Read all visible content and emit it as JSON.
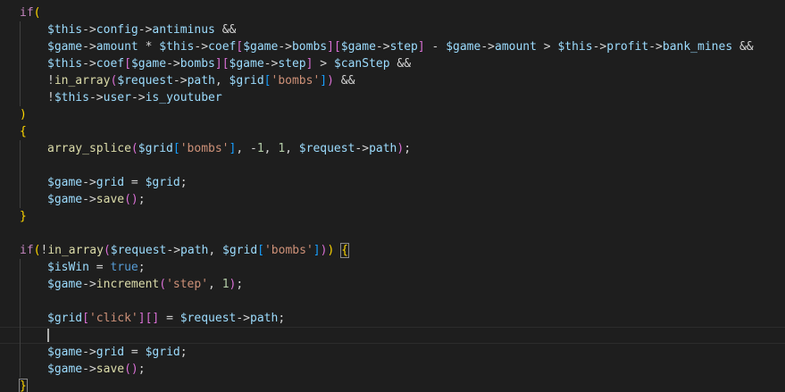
{
  "editor": {
    "language": "php",
    "colors": {
      "background": "#1e1e1e",
      "current_line_border": "#2c2c2c",
      "indent_guide": "#404040",
      "variable": "#9cdcfe",
      "keyword": "#c586c0",
      "control_keyword": "#c586c0",
      "function": "#dcdcaa",
      "string": "#ce9178",
      "number": "#b5cea8",
      "constant": "#569cd6",
      "operator": "#d4d4d4",
      "bracket_gold": "#ffd700",
      "bracket_purple": "#da70d6",
      "bracket_blue": "#179fff"
    },
    "lines": [
      {
        "text": "if(",
        "indent": 0,
        "tokens": [
          [
            "if",
            "control"
          ],
          [
            "(",
            "b1"
          ]
        ]
      },
      {
        "text": "$this->config->antiminus &&",
        "indent": 1,
        "tokens": [
          [
            "$this",
            "var"
          ],
          [
            "->",
            "op"
          ],
          [
            "config",
            "var"
          ],
          [
            "->",
            "op"
          ],
          [
            "antiminus",
            "var"
          ],
          [
            " &&",
            "op"
          ]
        ]
      },
      {
        "text": "$game->amount * $this->coef[$game->bombs][$game->step] - $game->amount > $this->profit->bank_mines &&",
        "indent": 1,
        "tokens": [
          [
            "$game",
            "var"
          ],
          [
            "->",
            "op"
          ],
          [
            "amount",
            "var"
          ],
          [
            " * ",
            "op"
          ],
          [
            "$this",
            "var"
          ],
          [
            "->",
            "op"
          ],
          [
            "coef",
            "var"
          ],
          [
            "[",
            "b2"
          ],
          [
            "$game",
            "var"
          ],
          [
            "->",
            "op"
          ],
          [
            "bombs",
            "var"
          ],
          [
            "]",
            "b2"
          ],
          [
            "[",
            "b2"
          ],
          [
            "$game",
            "var"
          ],
          [
            "->",
            "op"
          ],
          [
            "step",
            "var"
          ],
          [
            "]",
            "b2"
          ],
          [
            " - ",
            "op"
          ],
          [
            "$game",
            "var"
          ],
          [
            "->",
            "op"
          ],
          [
            "amount",
            "var"
          ],
          [
            " > ",
            "op"
          ],
          [
            "$this",
            "var"
          ],
          [
            "->",
            "op"
          ],
          [
            "profit",
            "var"
          ],
          [
            "->",
            "op"
          ],
          [
            "bank_mines",
            "var"
          ],
          [
            " &&",
            "op"
          ]
        ]
      },
      {
        "text": "$this->coef[$game->bombs][$game->step] > $canStep &&",
        "indent": 1,
        "tokens": [
          [
            "$this",
            "var"
          ],
          [
            "->",
            "op"
          ],
          [
            "coef",
            "var"
          ],
          [
            "[",
            "b2"
          ],
          [
            "$game",
            "var"
          ],
          [
            "->",
            "op"
          ],
          [
            "bombs",
            "var"
          ],
          [
            "]",
            "b2"
          ],
          [
            "[",
            "b2"
          ],
          [
            "$game",
            "var"
          ],
          [
            "->",
            "op"
          ],
          [
            "step",
            "var"
          ],
          [
            "]",
            "b2"
          ],
          [
            " > ",
            "op"
          ],
          [
            "$canStep",
            "var"
          ],
          [
            " &&",
            "op"
          ]
        ]
      },
      {
        "text": "!in_array($request->path, $grid['bombs']) &&",
        "indent": 1,
        "tokens": [
          [
            "!",
            "op"
          ],
          [
            "in_array",
            "fn"
          ],
          [
            "(",
            "b2"
          ],
          [
            "$request",
            "var"
          ],
          [
            "->",
            "op"
          ],
          [
            "path",
            "var"
          ],
          [
            ", ",
            "op"
          ],
          [
            "$grid",
            "var"
          ],
          [
            "[",
            "b3"
          ],
          [
            "'bombs'",
            "str"
          ],
          [
            "]",
            "b3"
          ],
          [
            ")",
            "b2"
          ],
          [
            " &&",
            "op"
          ]
        ]
      },
      {
        "text": "!$this->user->is_youtuber",
        "indent": 1,
        "tokens": [
          [
            "!",
            "op"
          ],
          [
            "$this",
            "var"
          ],
          [
            "->",
            "op"
          ],
          [
            "user",
            "var"
          ],
          [
            "->",
            "op"
          ],
          [
            "is_youtuber",
            "var"
          ]
        ]
      },
      {
        "text": ")",
        "indent": 0,
        "tokens": [
          [
            ")",
            "b1"
          ]
        ]
      },
      {
        "text": "{",
        "indent": 0,
        "tokens": [
          [
            "{",
            "b1"
          ]
        ]
      },
      {
        "text": "array_splice($grid['bombs'], -1, 1, $request->path);",
        "indent": 1,
        "tokens": [
          [
            "array_splice",
            "fn"
          ],
          [
            "(",
            "b2"
          ],
          [
            "$grid",
            "var"
          ],
          [
            "[",
            "b3"
          ],
          [
            "'bombs'",
            "str"
          ],
          [
            "]",
            "b3"
          ],
          [
            ", ",
            "op"
          ],
          [
            "-",
            "op"
          ],
          [
            "1",
            "num"
          ],
          [
            ", ",
            "op"
          ],
          [
            "1",
            "num"
          ],
          [
            ", ",
            "op"
          ],
          [
            "$request",
            "var"
          ],
          [
            "->",
            "op"
          ],
          [
            "path",
            "var"
          ],
          [
            ")",
            "b2"
          ],
          [
            ";",
            "op"
          ]
        ]
      },
      {
        "text": "",
        "indent": 1,
        "tokens": []
      },
      {
        "text": "$game->grid = $grid;",
        "indent": 1,
        "tokens": [
          [
            "$game",
            "var"
          ],
          [
            "->",
            "op"
          ],
          [
            "grid",
            "var"
          ],
          [
            " = ",
            "op"
          ],
          [
            "$grid",
            "var"
          ],
          [
            ";",
            "op"
          ]
        ]
      },
      {
        "text": "$game->save();",
        "indent": 1,
        "tokens": [
          [
            "$game",
            "var"
          ],
          [
            "->",
            "op"
          ],
          [
            "save",
            "fn"
          ],
          [
            "()",
            "b2"
          ],
          [
            ";",
            "op"
          ]
        ]
      },
      {
        "text": "}",
        "indent": 0,
        "tokens": [
          [
            "}",
            "b1"
          ]
        ]
      },
      {
        "text": "",
        "indent": 0,
        "tokens": []
      },
      {
        "text": "if(!in_array($request->path, $grid['bombs'])) {",
        "indent": 0,
        "tokens": [
          [
            "if",
            "control"
          ],
          [
            "(",
            "b1"
          ],
          [
            "!",
            "op"
          ],
          [
            "in_array",
            "fn"
          ],
          [
            "(",
            "b2"
          ],
          [
            "$request",
            "var"
          ],
          [
            "->",
            "op"
          ],
          [
            "path",
            "var"
          ],
          [
            ", ",
            "op"
          ],
          [
            "$grid",
            "var"
          ],
          [
            "[",
            "b3"
          ],
          [
            "'bombs'",
            "str"
          ],
          [
            "]",
            "b3"
          ],
          [
            ")",
            "b2"
          ],
          [
            ")",
            "b1"
          ],
          [
            " ",
            "op"
          ],
          [
            "{",
            "b1box"
          ]
        ]
      },
      {
        "text": "$isWin = true;",
        "indent": 1,
        "tokens": [
          [
            "$isWin",
            "var"
          ],
          [
            " = ",
            "op"
          ],
          [
            "true",
            "const"
          ],
          [
            ";",
            "op"
          ]
        ]
      },
      {
        "text": "$game->increment('step', 1);",
        "indent": 1,
        "tokens": [
          [
            "$game",
            "var"
          ],
          [
            "->",
            "op"
          ],
          [
            "increment",
            "fn"
          ],
          [
            "(",
            "b2"
          ],
          [
            "'step'",
            "str"
          ],
          [
            ", ",
            "op"
          ],
          [
            "1",
            "num"
          ],
          [
            ")",
            "b2"
          ],
          [
            ";",
            "op"
          ]
        ]
      },
      {
        "text": "",
        "indent": 1,
        "tokens": []
      },
      {
        "text": "$grid['click'][] = $request->path;",
        "indent": 1,
        "tokens": [
          [
            "$grid",
            "var"
          ],
          [
            "[",
            "b2"
          ],
          [
            "'click'",
            "str"
          ],
          [
            "]",
            "b2"
          ],
          [
            "[]",
            "b2"
          ],
          [
            " = ",
            "op"
          ],
          [
            "$request",
            "var"
          ],
          [
            "->",
            "op"
          ],
          [
            "path",
            "var"
          ],
          [
            ";",
            "op"
          ]
        ]
      },
      {
        "text": "",
        "indent": 1,
        "tokens": [],
        "current": true
      },
      {
        "text": "$game->grid = $grid;",
        "indent": 1,
        "tokens": [
          [
            "$game",
            "var"
          ],
          [
            "->",
            "op"
          ],
          [
            "grid",
            "var"
          ],
          [
            " = ",
            "op"
          ],
          [
            "$grid",
            "var"
          ],
          [
            ";",
            "op"
          ]
        ]
      },
      {
        "text": "$game->save();",
        "indent": 1,
        "tokens": [
          [
            "$game",
            "var"
          ],
          [
            "->",
            "op"
          ],
          [
            "save",
            "fn"
          ],
          [
            "()",
            "b2"
          ],
          [
            ";",
            "op"
          ]
        ]
      },
      {
        "text": "}",
        "indent": 0,
        "tokens": [
          [
            "}",
            "b1box"
          ]
        ]
      }
    ]
  }
}
